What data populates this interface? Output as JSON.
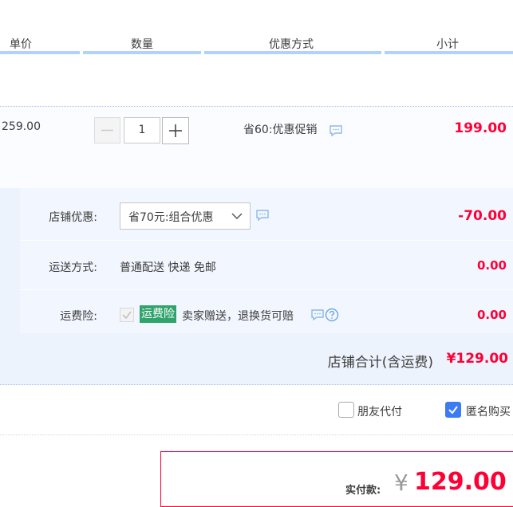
{
  "header": {
    "columns": [
      "单价",
      "数量",
      "优惠方式",
      "小计"
    ]
  },
  "item": {
    "unit_price": "259.00",
    "quantity": "1",
    "promotion": "省60:优惠促销",
    "subtotal": "199.00"
  },
  "shop": {
    "discount_label": "店铺优惠:",
    "discount_selected": "省70元:组合优惠",
    "discount_amount": "-70.00",
    "shipping_label": "运送方式:",
    "shipping_value": "普通配送 快递 免邮",
    "shipping_amount": "0.00",
    "insurance_label": "运费险:",
    "insurance_tag": "运费险",
    "insurance_desc": "卖家赠送，退换货可赔",
    "insurance_amount": "0.00",
    "total_label": "店铺合计(含运费)",
    "total_value": "¥129.00"
  },
  "options": {
    "friend_pay_label": "朋友代付",
    "friend_pay_checked": false,
    "anonymous_label": "匿名购买",
    "anonymous_checked": true
  },
  "payment": {
    "label": "实付款:",
    "currency": "¥",
    "amount": "129.00"
  },
  "colors": {
    "accent_red": "#ff0036",
    "header_bar": "#b2d1ff",
    "checkbox_blue": "#3d7bf5",
    "insurance_green": "#2fa36b"
  },
  "icons": [
    "chat-bubble-icon",
    "chevron-down-icon",
    "help-circle-icon",
    "checkmark-icon",
    "minus-icon",
    "plus-icon"
  ]
}
